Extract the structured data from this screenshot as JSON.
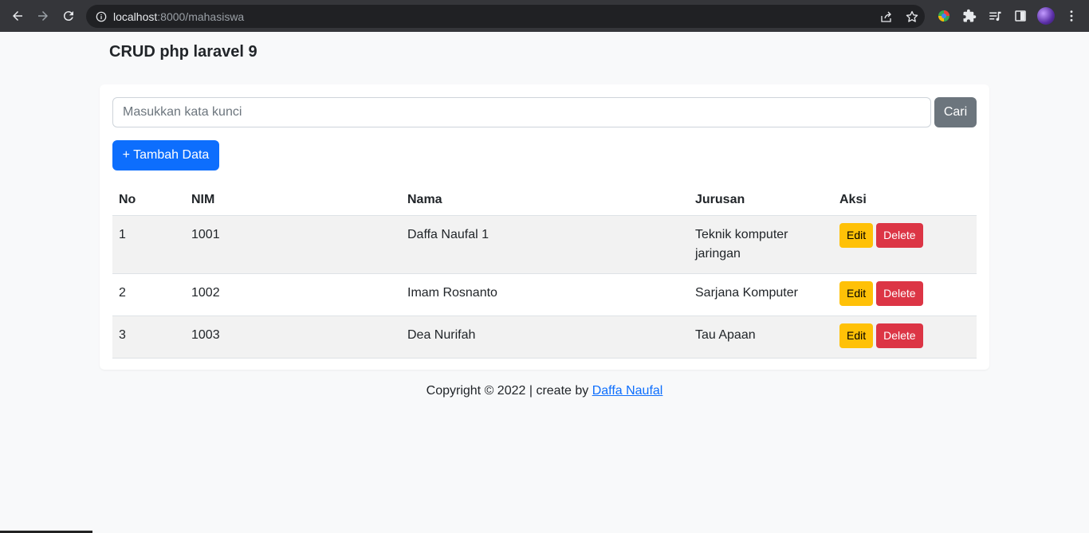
{
  "browser": {
    "url_host": "localhost",
    "url_rest": ":8000/mahasiswa"
  },
  "page": {
    "brand": "CRUD php laravel 9",
    "search": {
      "placeholder": "Masukkan kata kunci",
      "value": "",
      "button": "Cari"
    },
    "add_button": "+ Tambah Data",
    "table": {
      "headers": [
        "No",
        "NIM",
        "Nama",
        "Jurusan",
        "Aksi"
      ],
      "rows": [
        {
          "no": "1",
          "nim": "1001",
          "nama": "Daffa Naufal 1",
          "jurusan": "Teknik komputer jaringan"
        },
        {
          "no": "2",
          "nim": "1002",
          "nama": "Imam Rosnanto",
          "jurusan": "Sarjana Komputer"
        },
        {
          "no": "3",
          "nim": "1003",
          "nama": "Dea Nurifah",
          "jurusan": "Tau Apaan"
        }
      ],
      "edit_label": "Edit",
      "delete_label": "Delete"
    },
    "footer": {
      "text": "Copyright © 2022 | create by",
      "link": "Daffa Naufal"
    }
  },
  "colors": {
    "primary": "#0d6efd",
    "secondary": "#6c757d",
    "warning": "#ffc107",
    "danger": "#dc3545"
  }
}
